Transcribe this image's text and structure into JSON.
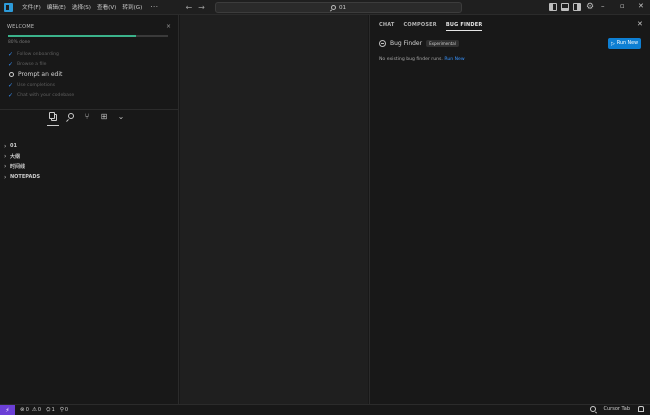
{
  "titlebar": {
    "menus": [
      "文件(F)",
      "编辑(E)",
      "选择(S)",
      "查看(V)",
      "转到(G)",
      "···"
    ],
    "search_text": "01",
    "back_glyph": "←",
    "forward_glyph": "→",
    "gear_glyph": "⚙",
    "minimize_glyph": "–",
    "maximize_glyph": "▫",
    "close_glyph": "✕"
  },
  "welcome": {
    "header": "WELCOME",
    "close_glyph": "×",
    "progress_fraction": 0.8,
    "progress_text": "80% done",
    "steps": [
      {
        "label": "Follow onboarding",
        "done": true,
        "active": false
      },
      {
        "label": "Browse a file",
        "done": true,
        "active": false
      },
      {
        "label": "Prompt an edit",
        "done": false,
        "active": true
      },
      {
        "label": "Use completions",
        "done": true,
        "active": false
      },
      {
        "label": "Chat with your codebase",
        "done": true,
        "active": false
      }
    ],
    "check_glyph": "✓"
  },
  "activity": {
    "source_control_glyph": "⑂",
    "extensions_glyph": "⊞",
    "more_glyph": "⌄"
  },
  "explorer": {
    "chevron_glyph": "›",
    "items": [
      "01",
      "大纲",
      "时间线",
      "NOTEPADS"
    ]
  },
  "panel": {
    "tabs": [
      "CHAT",
      "COMPOSER",
      "BUG FINDER"
    ],
    "active_tab": "BUG FINDER",
    "close_glyph": "✕",
    "title": "Bug Finder",
    "badge": "Experimental",
    "run_button": "Run New",
    "run_glyph": "▷",
    "empty_text": "No existing bug finder runs.",
    "empty_link": "Run New"
  },
  "statusbar": {
    "remote_glyph": "⚡",
    "errors": "0",
    "warnings": "0",
    "error_glyph": "⊗",
    "warning_glyph": "⚠",
    "ports_glyph": "⛭",
    "ports": "1",
    "radio_glyph": "⚲",
    "radio": "0",
    "cursor_tab": "Cursor Tab"
  },
  "colors": {
    "accent": "#0e7fd3",
    "progress": "#3bb28b",
    "check": "#3794ff",
    "remote": "#6b3fd6"
  }
}
